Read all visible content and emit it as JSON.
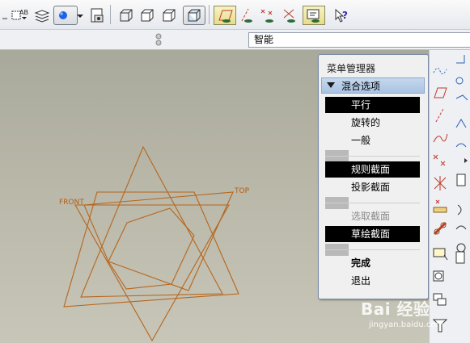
{
  "status": {
    "smart_filter": "智能"
  },
  "canvas": {
    "datum_labels": [
      "FRONT",
      "TOP"
    ],
    "colors": {
      "geometry": "#b8651b",
      "label": "#b85d10"
    }
  },
  "menu_manager": {
    "title": "菜单管理器",
    "group_label": "混合选项",
    "items": [
      {
        "label": "平行",
        "state": "selected"
      },
      {
        "label": "旋转的",
        "state": "normal"
      },
      {
        "label": "一般",
        "state": "normal"
      },
      {
        "label": "规则截面",
        "state": "selected"
      },
      {
        "label": "投影截面",
        "state": "normal"
      },
      {
        "label": "选取截面",
        "state": "disabled"
      },
      {
        "label": "草绘截面",
        "state": "selected"
      },
      {
        "label": "完成",
        "state": "bold"
      },
      {
        "label": "退出",
        "state": "normal"
      }
    ]
  },
  "watermark": {
    "main": "Bai 经验",
    "sub": "jingyan.baidu.com"
  },
  "icons": [
    "new-datum-icon",
    "layers-icon",
    "view-orientation-icon",
    "save-view-icon",
    "wireframe-icon",
    "hidden-line-icon",
    "no-hidden-icon",
    "shading-icon",
    "datum-plane-display-icon",
    "datum-axis-display-icon",
    "datum-point-display-icon",
    "csys-display-icon",
    "annotation-display-icon",
    "help-icon"
  ]
}
